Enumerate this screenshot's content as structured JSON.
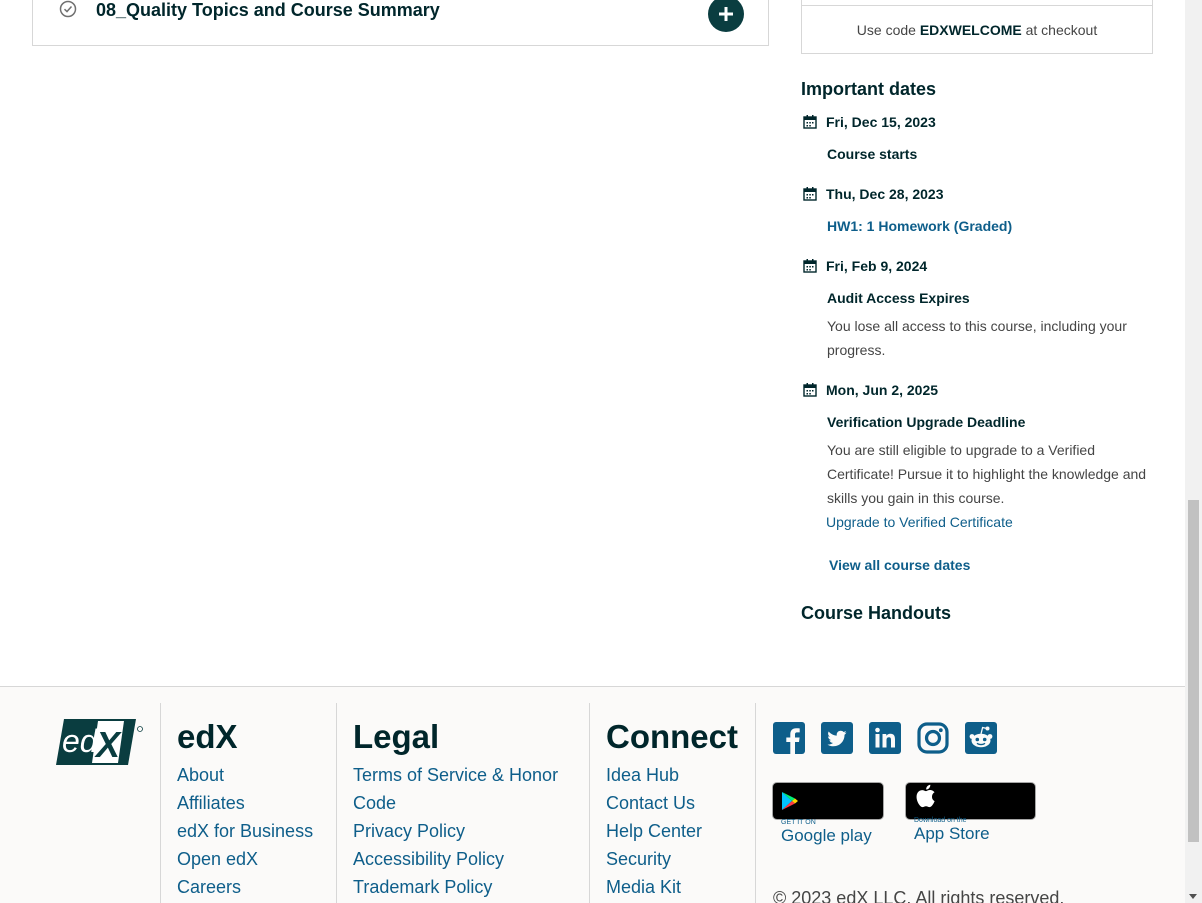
{
  "section": {
    "title": "08_Quality Topics and Course Summary",
    "expand_symbol": "+"
  },
  "promo": {
    "prefix": "Use code ",
    "code": "EDXWELCOME",
    "suffix": " at checkout"
  },
  "important_dates": {
    "heading": "Important dates",
    "items": [
      {
        "date": "Fri, Dec 15, 2023",
        "title": "Course starts"
      },
      {
        "date": "Thu, Dec 28, 2023",
        "title": "HW1: 1 Homework (Graded)"
      },
      {
        "date": "Fri, Feb 9, 2024",
        "title": "Audit Access Expires",
        "description": "You lose all access to this course, including your progress."
      },
      {
        "date": "Mon, Jun 2, 2025",
        "title": "Verification Upgrade Deadline",
        "description": "You are still eligible to upgrade to a Verified Certificate! Pursue it to highlight the knowledge and skills you gain in this course.",
        "link": "Upgrade to Verified Certificate"
      }
    ],
    "view_all": "View all course dates"
  },
  "handouts": {
    "heading": "Course Handouts"
  },
  "footer": {
    "logo_text": "edX",
    "edx": {
      "heading": "edX",
      "links": [
        "About",
        "Affiliates",
        "edX for Business",
        "Open edX",
        "Careers"
      ]
    },
    "legal": {
      "heading": "Legal",
      "links": [
        "Terms of Service & Honor Code",
        "Privacy Policy",
        "Accessibility Policy",
        "Trademark Policy"
      ]
    },
    "connect": {
      "heading": "Connect",
      "links": [
        "Idea Hub",
        "Contact Us",
        "Help Center",
        "Security",
        "Media Kit"
      ]
    },
    "social": [
      "facebook-icon",
      "twitter-icon",
      "linkedin-icon",
      "instagram-icon",
      "reddit-icon"
    ],
    "stores": {
      "google": {
        "small": "GET IT ON",
        "big": "Google play"
      },
      "apple": {
        "small": "Download on the",
        "big": "App Store"
      }
    },
    "copyright": "© 2023 edX LLC. All rights reserved."
  },
  "colors": {
    "brand_dark": "#00262b",
    "link": "#0e5e8a",
    "button": "#0a3d40"
  }
}
